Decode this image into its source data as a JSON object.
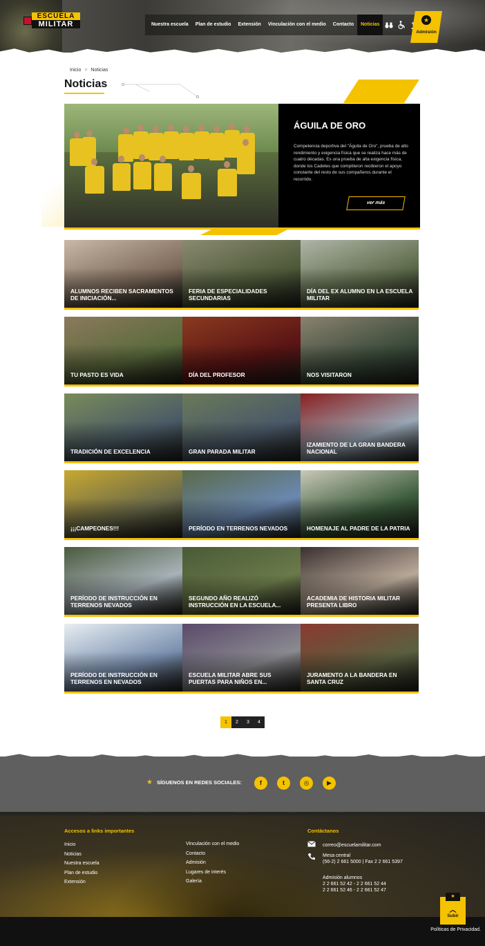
{
  "header": {
    "logo_top": "ESCUELA",
    "logo_bottom": "MILITAR",
    "logo_sub": "",
    "nav": [
      {
        "label": "Nuestra escuela"
      },
      {
        "label": "Plan de estudio"
      },
      {
        "label": "Extensión"
      },
      {
        "label": "Vinculación con el medio"
      },
      {
        "label": "Contacto"
      },
      {
        "label": "Noticias"
      }
    ],
    "icons": [
      "binoculars-icon",
      "wheelchair-icon",
      "user-soldier-icon"
    ],
    "admision_label": "Admisión"
  },
  "breadcrumb": {
    "home": "Inicio",
    "separator": ">",
    "current": "Noticias"
  },
  "page_title": "Noticias",
  "featured": {
    "title": "ÁGUILA DE ORO",
    "description": "Competencia deportiva del \"Águila de Oro\", prueba de alto rendimiento y exigencia física que se realiza hace más de cuatro décadas. Es una prueba de alta exigencia física, donde los Cadetes que compitieron recibieron el apoyo constante del resto de sus compañeros durante el recorrido.",
    "button": "ver más"
  },
  "news": [
    {
      "title": "ALUMNOS RECIBEN SACRAMENTOS DE INICIACIÓN...",
      "bg": "#7d6a5a",
      "bg2": "#c8b8a6"
    },
    {
      "title": "FERIA DE ESPECIALIDADES SECUNDARIAS",
      "bg": "#4f5a3a",
      "bg2": "#8a8a70"
    },
    {
      "title": "DÍA DEL EX ALUMNO EN LA ESCUELA MILITAR",
      "bg": "#5d6b4a",
      "bg2": "#b0b5a8"
    },
    {
      "title": "TU PASTO ES VIDA",
      "bg": "#5a6a3c",
      "bg2": "#8b7a5c"
    },
    {
      "title": "DÍA DEL PROFESOR",
      "bg": "#5a1414",
      "bg2": "#8a3a20"
    },
    {
      "title": "NOS VISITARON",
      "bg": "#3a4a3a",
      "bg2": "#8a8270"
    },
    {
      "title": "TRADICIÓN DE EXCELENCIA",
      "bg": "#4a5a66",
      "bg2": "#7a8c5a"
    },
    {
      "title": "GRAN PARADA MILITAR",
      "bg": "#4a5868",
      "bg2": "#6a7a5a"
    },
    {
      "title": "IZAMIENTO DE LA GRAN BANDERA NACIONAL",
      "bg": "#9aa8b6",
      "bg2": "#8a2020"
    },
    {
      "title": "¡¡¡CAMPEONES!!!",
      "bg": "#6a6a4a",
      "bg2": "#c8a830"
    },
    {
      "title": "PERÍODO EN TERRENOS NEVADOS",
      "bg": "#6a88b0",
      "bg2": "#5a6a4a"
    },
    {
      "title": "HOMENAJE AL PADRE DE LA PATRIA",
      "bg": "#3a5a3a",
      "bg2": "#c8c8b8"
    },
    {
      "title": "PERÍODO DE INSTRUCCIÓN EN TERRENOS NEVADOS",
      "bg": "#a8b2b8",
      "bg2": "#4a5a3e"
    },
    {
      "title": "SEGUNDO AÑO REALIZÓ INSTRUCCIÓN EN LA ESCUELA...",
      "bg": "#6a7a4a",
      "bg2": "#4a5a36"
    },
    {
      "title": "ACADEMIA DE HISTORIA MILITAR PRESENTA LIBRO",
      "bg": "#b8a898",
      "bg2": "#3a3030"
    },
    {
      "title": "PERÍODO DE INSTRUCCIÓN EN TERRENOS EN NEVADOS",
      "bg": "#7a90b0",
      "bg2": "#e8eef2"
    },
    {
      "title": "ESCUELA MILITAR ABRE SUS PUERTAS PARA NIÑOS EN...",
      "bg": "#8a8a90",
      "bg2": "#5a4a6a"
    },
    {
      "title": "JURAMENTO A LA BANDERA EN SANTA CRUZ",
      "bg": "#5a6040",
      "bg2": "#8a3a30"
    }
  ],
  "pagination": [
    "1",
    "2",
    "3",
    "4"
  ],
  "social": {
    "label": "SÍGUENOS EN REDES SOCIALES:",
    "icons": [
      {
        "name": "facebook-icon",
        "glyph": "f"
      },
      {
        "name": "twitter-icon",
        "glyph": "t"
      },
      {
        "name": "instagram-icon",
        "glyph": "◎"
      },
      {
        "name": "youtube-icon",
        "glyph": "▶"
      }
    ]
  },
  "footer": {
    "links_title": "Accesos a links importantes",
    "links_col1": [
      "Inicio",
      "Noticias",
      "Nuestra escuela",
      "Plan de estudio",
      "Extensión"
    ],
    "links_col2": [
      "Vinculación con el medio",
      "Contacto",
      "Admisión",
      "Lugares de interés",
      "Galería"
    ],
    "contact_title": "Contáctanos",
    "email": "correo@escuelamilitar.com",
    "phone_title": "Mesa central",
    "phone": "(56-2) 2 661 5000 | Fax 2 2 661 5397",
    "admision_title": "Admisión alumnos",
    "admision_phones_1": "2 2 661 52 42 - 2 2 661 52 44",
    "admision_phones_2": "2 2 661 52 46 - 2 2 661 52 47",
    "subir": "Subir",
    "privacy": "Políticas de Privacidad."
  },
  "colors": {
    "accent": "#f5c200",
    "dark": "#111111",
    "social_band": "#5f5f5f"
  }
}
